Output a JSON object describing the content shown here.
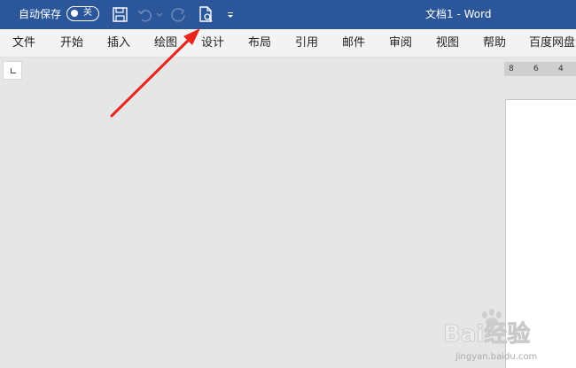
{
  "titlebar": {
    "autosave_label": "自动保存",
    "autosave_state": "关",
    "doc_title": "文档1  -  Word"
  },
  "qat": {
    "icons": [
      "save-icon",
      "undo-icon",
      "redo-icon",
      "print-preview-icon",
      "customize-qat-icon"
    ]
  },
  "menu": {
    "items": [
      "文件",
      "开始",
      "插入",
      "绘图",
      "设计",
      "布局",
      "引用",
      "邮件",
      "审阅",
      "视图",
      "帮助",
      "百度网盘"
    ]
  },
  "ruler": {
    "numbers": [
      "8",
      "6",
      "4"
    ]
  },
  "watermark": {
    "text": "Bai经验",
    "url": "jingyan.baidu.com"
  },
  "colors": {
    "titlebar": "#2b579a",
    "annotation_arrow": "#e8241c"
  }
}
